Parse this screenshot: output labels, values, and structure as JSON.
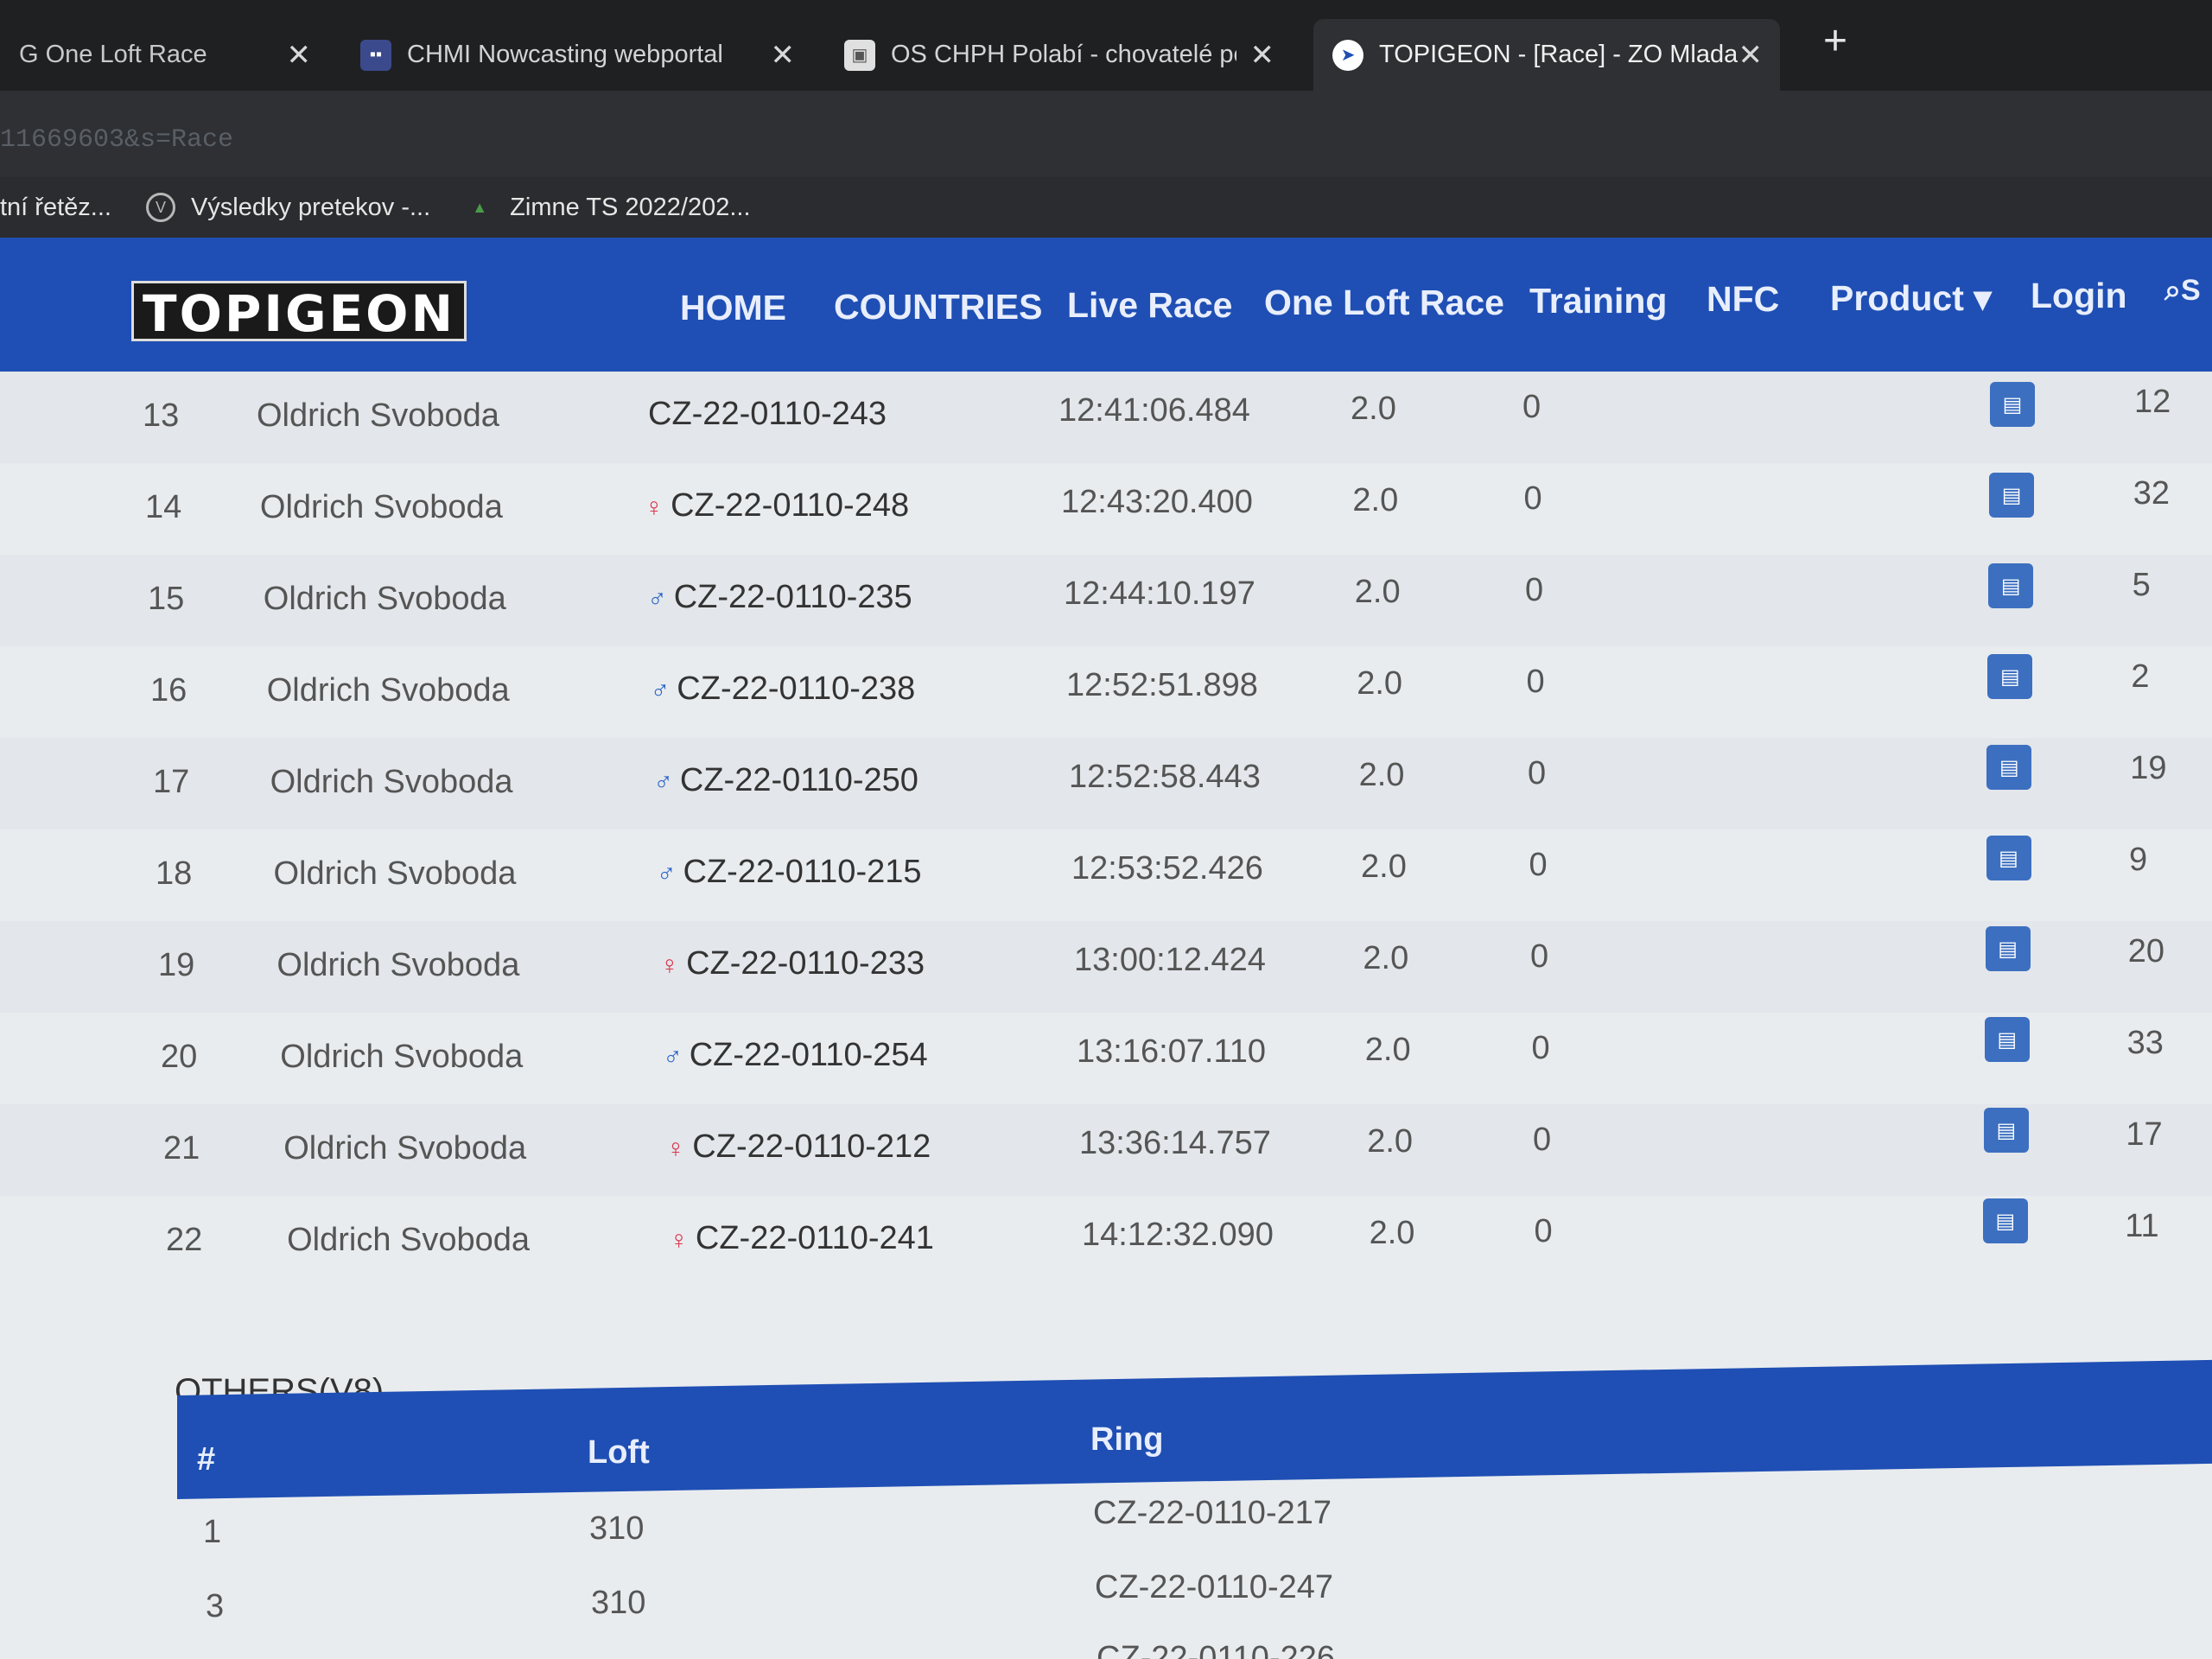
{
  "browser": {
    "tabs": [
      {
        "title": "G One Loft Race",
        "active": false
      },
      {
        "title": "CHMI Nowcasting webportal",
        "active": false
      },
      {
        "title": "OS CHPH Polabí - chovatelé po",
        "active": false
      },
      {
        "title": "TOPIGEON - [Race] - ZO Mlada",
        "active": true
      }
    ],
    "close_glyph": "✕",
    "new_tab_glyph": "+",
    "url": "11669603&s=Race",
    "bookmarks": [
      "tní řetěz...",
      "Výsledky pretekov -...",
      "Zimne TS 2022/202..."
    ]
  },
  "site": {
    "logo": "TOPIGEON",
    "nav": [
      "HOME",
      "COUNTRIES",
      "Live Race",
      "One Loft Race",
      "Training",
      "NFC",
      "Product ▾",
      "Login"
    ],
    "search_icon": "search-icon",
    "search_label": "S"
  },
  "results": [
    {
      "pos": "13",
      "name": "Oldrich Svoboda",
      "sex": "",
      "ring": "CZ-22-0110-243",
      "time": "12:41:06.484",
      "v": "2.0",
      "z": "0",
      "n": "12"
    },
    {
      "pos": "14",
      "name": "Oldrich Svoboda",
      "sex": "♀",
      "ring": "CZ-22-0110-248",
      "time": "12:43:20.400",
      "v": "2.0",
      "z": "0",
      "n": "32"
    },
    {
      "pos": "15",
      "name": "Oldrich Svoboda",
      "sex": "♂",
      "ring": "CZ-22-0110-235",
      "time": "12:44:10.197",
      "v": "2.0",
      "z": "0",
      "n": "5"
    },
    {
      "pos": "16",
      "name": "Oldrich Svoboda",
      "sex": "♂",
      "ring": "CZ-22-0110-238",
      "time": "12:52:51.898",
      "v": "2.0",
      "z": "0",
      "n": "2"
    },
    {
      "pos": "17",
      "name": "Oldrich Svoboda",
      "sex": "♂",
      "ring": "CZ-22-0110-250",
      "time": "12:52:58.443",
      "v": "2.0",
      "z": "0",
      "n": "19"
    },
    {
      "pos": "18",
      "name": "Oldrich Svoboda",
      "sex": "♂",
      "ring": "CZ-22-0110-215",
      "time": "12:53:52.426",
      "v": "2.0",
      "z": "0",
      "n": "9"
    },
    {
      "pos": "19",
      "name": "Oldrich Svoboda",
      "sex": "♀",
      "ring": "CZ-22-0110-233",
      "time": "13:00:12.424",
      "v": "2.0",
      "z": "0",
      "n": "20"
    },
    {
      "pos": "20",
      "name": "Oldrich Svoboda",
      "sex": "♂",
      "ring": "CZ-22-0110-254",
      "time": "13:16:07.110",
      "v": "2.0",
      "z": "0",
      "n": "33"
    },
    {
      "pos": "21",
      "name": "Oldrich Svoboda",
      "sex": "♀",
      "ring": "CZ-22-0110-212",
      "time": "13:36:14.757",
      "v": "2.0",
      "z": "0",
      "n": "17"
    },
    {
      "pos": "22",
      "name": "Oldrich Svoboda",
      "sex": "♀",
      "ring": "CZ-22-0110-241",
      "time": "14:12:32.090",
      "v": "2.0",
      "z": "0",
      "n": "11"
    }
  ],
  "others": {
    "title": "OTHERS(V8)",
    "headers": [
      "#",
      "Loft",
      "Ring"
    ],
    "rows": [
      {
        "num": "1",
        "loft": "310",
        "ring": "CZ-22-0110-217"
      },
      {
        "num": "3",
        "loft": "310",
        "ring": "CZ-22-0110-247"
      },
      {
        "num": "",
        "loft": "",
        "ring": "CZ-22-0110-226"
      }
    ]
  },
  "colors": {
    "brand": "#1f4fb4",
    "female": "#d9364d",
    "male": "#2864c8",
    "map_button": "#3c6fc0"
  }
}
